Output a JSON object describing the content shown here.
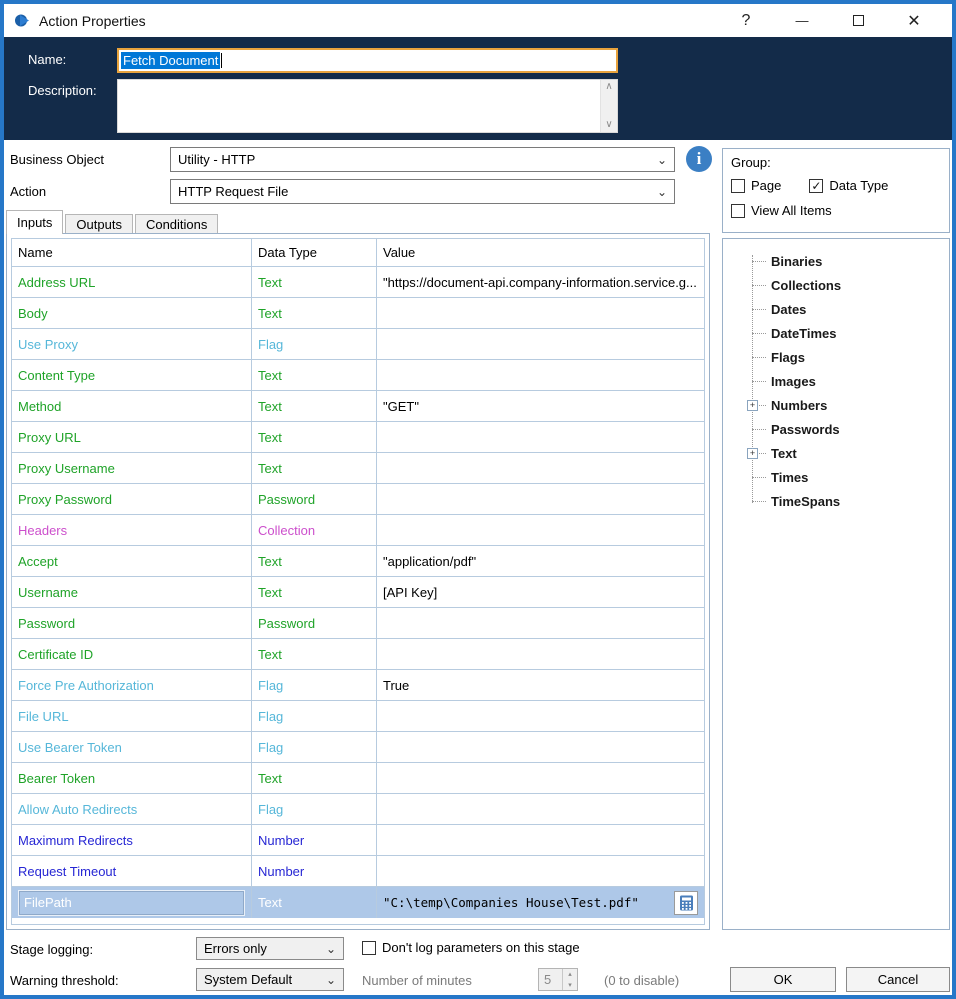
{
  "colors": {
    "window_border": "#2677c8",
    "navy_header": "#132b49",
    "name_field_border": "#e8a33d",
    "text_selection": "#0078d7",
    "selected_row_bg": "#aec8e8",
    "grid_line": "#b7cbdf",
    "types": {
      "green": "#1fa328",
      "cyan": "#56b7d9",
      "magenta": "#cc4fcc",
      "blue": "#2626d4"
    }
  },
  "titlebar": {
    "title": "Action Properties",
    "help": "?",
    "minimize": "—",
    "close": "✕"
  },
  "header": {
    "name_label": "Name:",
    "name_value": "Fetch Document",
    "description_label": "Description:",
    "description_value": ""
  },
  "selectors": {
    "business_object_label": "Business Object",
    "business_object_value": "Utility - HTTP",
    "action_label": "Action",
    "action_value": "HTTP Request File",
    "info_icon": "i"
  },
  "tabs": [
    {
      "label": "Inputs",
      "active": true
    },
    {
      "label": "Outputs",
      "active": false
    },
    {
      "label": "Conditions",
      "active": false
    }
  ],
  "inputs_table": {
    "columns": [
      "Name",
      "Data Type",
      "Value"
    ],
    "rows": [
      {
        "name": "Address URL",
        "type": "Text",
        "value": "\"https://document-api.company-information.service.g...",
        "kind": "green",
        "selected": false
      },
      {
        "name": "Body",
        "type": "Text",
        "value": "",
        "kind": "green",
        "selected": false
      },
      {
        "name": "Use Proxy",
        "type": "Flag",
        "value": "",
        "kind": "cyan",
        "selected": false
      },
      {
        "name": "Content Type",
        "type": "Text",
        "value": "",
        "kind": "green",
        "selected": false
      },
      {
        "name": "Method",
        "type": "Text",
        "value": "\"GET\"",
        "kind": "green",
        "selected": false
      },
      {
        "name": "Proxy URL",
        "type": "Text",
        "value": "",
        "kind": "green",
        "selected": false
      },
      {
        "name": "Proxy Username",
        "type": "Text",
        "value": "",
        "kind": "green",
        "selected": false
      },
      {
        "name": "Proxy Password",
        "type": "Password",
        "value": "",
        "kind": "green",
        "selected": false
      },
      {
        "name": "Headers",
        "type": "Collection",
        "value": "",
        "kind": "magenta",
        "selected": false
      },
      {
        "name": "Accept",
        "type": "Text",
        "value": "\"application/pdf\"",
        "kind": "green",
        "selected": false
      },
      {
        "name": "Username",
        "type": "Text",
        "value": "[API Key]",
        "kind": "green",
        "selected": false
      },
      {
        "name": "Password",
        "type": "Password",
        "value": "",
        "kind": "green",
        "selected": false
      },
      {
        "name": "Certificate ID",
        "type": "Text",
        "value": "",
        "kind": "green",
        "selected": false
      },
      {
        "name": "Force Pre Authorization",
        "type": "Flag",
        "value": "True",
        "kind": "cyan",
        "selected": false
      },
      {
        "name": "File URL",
        "type": "Flag",
        "value": "",
        "kind": "cyan",
        "selected": false
      },
      {
        "name": "Use Bearer Token",
        "type": "Flag",
        "value": "",
        "kind": "cyan",
        "selected": false
      },
      {
        "name": "Bearer Token",
        "type": "Text",
        "value": "",
        "kind": "green",
        "selected": false
      },
      {
        "name": "Allow Auto Redirects",
        "type": "Flag",
        "value": "",
        "kind": "cyan",
        "selected": false
      },
      {
        "name": "Maximum Redirects",
        "type": "Number",
        "value": "",
        "kind": "blue",
        "selected": false
      },
      {
        "name": "Request Timeout",
        "type": "Number",
        "value": "",
        "kind": "blue",
        "selected": false
      },
      {
        "name": "FilePath",
        "type": "Text",
        "value": "\"C:\\temp\\Companies House\\Test.pdf\"",
        "kind": "green",
        "selected": true
      }
    ]
  },
  "group_panel": {
    "label": "Group:",
    "checkboxes": [
      {
        "label": "Page",
        "checked": false
      },
      {
        "label": "Data Type",
        "checked": true
      },
      {
        "label": "View All Items",
        "checked": false
      }
    ]
  },
  "tree": {
    "items": [
      {
        "label": "Binaries",
        "expandable": false
      },
      {
        "label": "Collections",
        "expandable": false
      },
      {
        "label": "Dates",
        "expandable": false
      },
      {
        "label": "DateTimes",
        "expandable": false
      },
      {
        "label": "Flags",
        "expandable": false
      },
      {
        "label": "Images",
        "expandable": false
      },
      {
        "label": "Numbers",
        "expandable": true
      },
      {
        "label": "Passwords",
        "expandable": false
      },
      {
        "label": "Text",
        "expandable": true
      },
      {
        "label": "Times",
        "expandable": false
      },
      {
        "label": "TimeSpans",
        "expandable": false
      }
    ]
  },
  "footer": {
    "stage_logging_label": "Stage logging:",
    "stage_logging_value": "Errors only",
    "dont_log_label": "Don't log parameters on this stage",
    "warning_threshold_label": "Warning threshold:",
    "warning_threshold_value": "System Default",
    "minutes_label": "Number of minutes",
    "minutes_value": "5",
    "disable_hint": "(0 to disable)",
    "ok_label": "OK",
    "cancel_label": "Cancel"
  }
}
